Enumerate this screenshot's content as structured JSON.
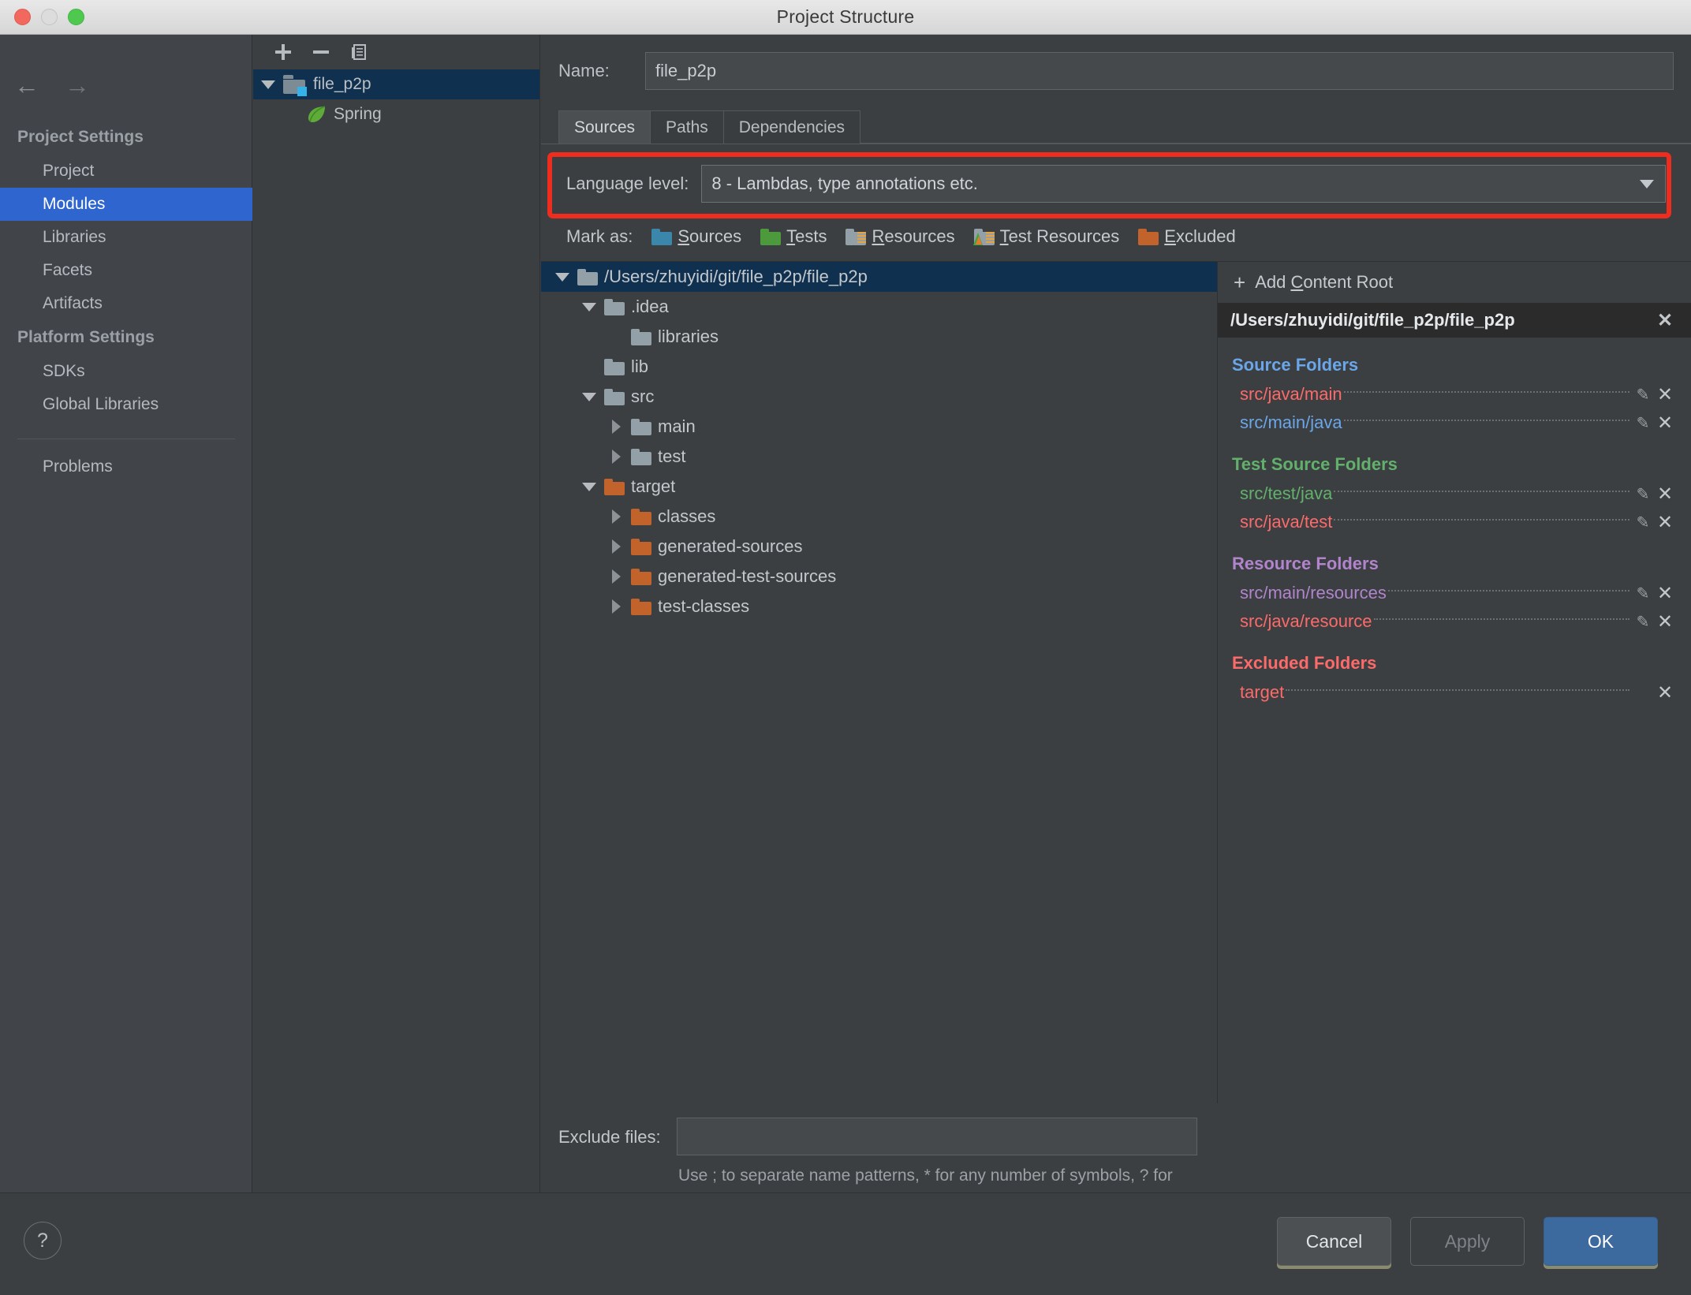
{
  "window": {
    "title": "Project Structure",
    "traffic_lights": [
      "close",
      "minimize",
      "zoom"
    ]
  },
  "sidebar": {
    "back_icon": "arrow-left-icon",
    "forward_icon": "arrow-right-icon",
    "groups": [
      {
        "label": "Project Settings",
        "items": [
          {
            "label": "Project",
            "selected": false
          },
          {
            "label": "Modules",
            "selected": true
          },
          {
            "label": "Libraries",
            "selected": false
          },
          {
            "label": "Facets",
            "selected": false
          },
          {
            "label": "Artifacts",
            "selected": false
          }
        ]
      },
      {
        "label": "Platform Settings",
        "items": [
          {
            "label": "SDKs",
            "selected": false
          },
          {
            "label": "Global Libraries",
            "selected": false
          }
        ]
      }
    ],
    "extra_items": [
      {
        "label": "Problems"
      }
    ]
  },
  "module_panel": {
    "toolbar": [
      {
        "name": "add-module-button",
        "icon": "plus-icon"
      },
      {
        "name": "remove-module-button",
        "icon": "minus-icon"
      },
      {
        "name": "copy-module-button",
        "icon": "copy-icon"
      }
    ],
    "tree": [
      {
        "label": "file_p2p",
        "icon": "module-folder-icon",
        "expanded": true,
        "selected": true,
        "depth": 0
      },
      {
        "label": "Spring",
        "icon": "spring-leaf-icon",
        "expanded": false,
        "selected": false,
        "depth": 1
      }
    ]
  },
  "main": {
    "name_label": "Name:",
    "name_value": "file_p2p",
    "name_placeholder": "",
    "tabs": [
      {
        "label": "Sources",
        "active": true
      },
      {
        "label": "Paths",
        "active": false
      },
      {
        "label": "Dependencies",
        "active": false
      }
    ],
    "language_level": {
      "label": "Language level:",
      "value": "8 - Lambdas, type annotations etc.",
      "highlighted": true,
      "highlight_color": "#ef2d1e"
    },
    "mark_as": {
      "label": "Mark as:",
      "options": [
        {
          "label": "Sources",
          "mnemonic": "S",
          "color": "#3b87ab",
          "icon": "blue-folder-icon"
        },
        {
          "label": "Tests",
          "mnemonic": "T",
          "color": "#4c9a3b",
          "icon": "green-folder-icon"
        },
        {
          "label": "Resources",
          "mnemonic": "R",
          "color": "#93a0a8",
          "icon": "gray-resource-folder-icon"
        },
        {
          "label": "Test Resources",
          "mnemonic": "T",
          "color": "#93a0a8",
          "icon": "test-resource-folder-icon"
        },
        {
          "label": "Excluded",
          "mnemonic": "E",
          "color": "#c1632a",
          "icon": "orange-folder-icon"
        }
      ]
    },
    "file_tree": [
      {
        "label": "/Users/zhuyidi/git/file_p2p/file_p2p",
        "depth": 0,
        "state": "expanded",
        "color": "gray",
        "selected": true
      },
      {
        "label": ".idea",
        "depth": 1,
        "state": "expanded",
        "color": "gray",
        "selected": false
      },
      {
        "label": "libraries",
        "depth": 2,
        "state": "leaf",
        "color": "gray",
        "selected": false
      },
      {
        "label": "lib",
        "depth": 1,
        "state": "leaf",
        "color": "gray",
        "selected": false
      },
      {
        "label": "src",
        "depth": 1,
        "state": "expanded",
        "color": "gray",
        "selected": false
      },
      {
        "label": "main",
        "depth": 2,
        "state": "collapsed",
        "color": "gray",
        "selected": false
      },
      {
        "label": "test",
        "depth": 2,
        "state": "collapsed",
        "color": "gray",
        "selected": false
      },
      {
        "label": "target",
        "depth": 1,
        "state": "expanded",
        "color": "orange",
        "selected": false
      },
      {
        "label": "classes",
        "depth": 2,
        "state": "collapsed",
        "color": "orange",
        "selected": false
      },
      {
        "label": "generated-sources",
        "depth": 2,
        "state": "collapsed",
        "color": "orange",
        "selected": false
      },
      {
        "label": "generated-test-sources",
        "depth": 2,
        "state": "collapsed",
        "color": "orange",
        "selected": false
      },
      {
        "label": "test-classes",
        "depth": 2,
        "state": "collapsed",
        "color": "orange",
        "selected": false
      }
    ],
    "content_roots": {
      "add_label": "Add Content Root",
      "add_mnemonic": "C",
      "root_path": "/Users/zhuyidi/git/file_p2p/file_p2p",
      "groups": [
        {
          "title": "Source Folders",
          "title_color": "#6aa6e8",
          "entries": [
            {
              "path": "src/java/main",
              "color": "#fc6a6a",
              "has_edit": true,
              "has_remove": true
            },
            {
              "path": "src/main/java",
              "color": "#6aa6e8",
              "has_edit": true,
              "has_remove": true
            }
          ]
        },
        {
          "title": "Test Source Folders",
          "title_color": "#62b06c",
          "entries": [
            {
              "path": "src/test/java",
              "color": "#62b06c",
              "has_edit": true,
              "has_remove": true
            },
            {
              "path": "src/java/test",
              "color": "#fc6a6a",
              "has_edit": true,
              "has_remove": true
            }
          ]
        },
        {
          "title": "Resource Folders",
          "title_color": "#b184cc",
          "entries": [
            {
              "path": "src/main/resources",
              "color": "#b184cc",
              "has_edit": true,
              "has_remove": true
            },
            {
              "path": "src/java/resource",
              "color": "#fc6a6a",
              "has_edit": true,
              "has_remove": true
            }
          ]
        },
        {
          "title": "Excluded Folders",
          "title_color": "#fc6a6a",
          "entries": [
            {
              "path": "target",
              "color": "#fc6a6a",
              "has_edit": false,
              "has_remove": true
            }
          ]
        }
      ]
    },
    "exclude_files": {
      "label": "Exclude files:",
      "value": "",
      "placeholder": "",
      "hint": "Use ; to separate name patterns, * for any number of symbols, ? for one."
    }
  },
  "footer": {
    "help_icon": "question-mark-icon",
    "buttons": [
      {
        "label": "Cancel",
        "kind": "default"
      },
      {
        "label": "Apply",
        "kind": "disabled"
      },
      {
        "label": "OK",
        "kind": "primary"
      }
    ]
  }
}
